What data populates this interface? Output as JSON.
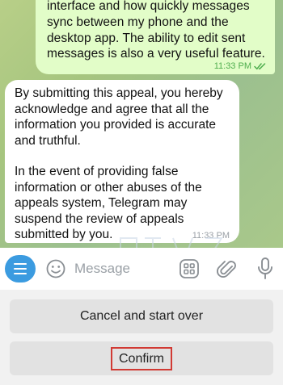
{
  "chat": {
    "outgoing": {
      "text": "interface and how quickly messages sync between my phone and the desktop app. The ability to edit sent messages is also a very useful feature.",
      "time": "11:33 PM",
      "status_icon": "double-check-icon",
      "bubble_color": "#e2fdc8",
      "time_color": "#4fae4e"
    },
    "incoming": {
      "paragraph_1": "By submitting this appeal, you hereby acknowledge and agree that all the information you provided is accurate and truthful.",
      "paragraph_2": "In the event of providing false information or other abuses of the appeals system, Telegram may suspend the review of appeals submitted by you.",
      "time": "11:33 PM",
      "bubble_color": "#ffffff"
    }
  },
  "input_bar": {
    "placeholder": "Message",
    "accent": "#3b9be0",
    "icons": [
      "menu-icon",
      "emoji-icon",
      "bot-commands-icon",
      "attach-icon",
      "microphone-icon"
    ]
  },
  "keyboard": {
    "buttons": [
      {
        "label": "Cancel and start over"
      },
      {
        "label": "Confirm",
        "highlight_color": "#d13a34"
      }
    ]
  }
}
